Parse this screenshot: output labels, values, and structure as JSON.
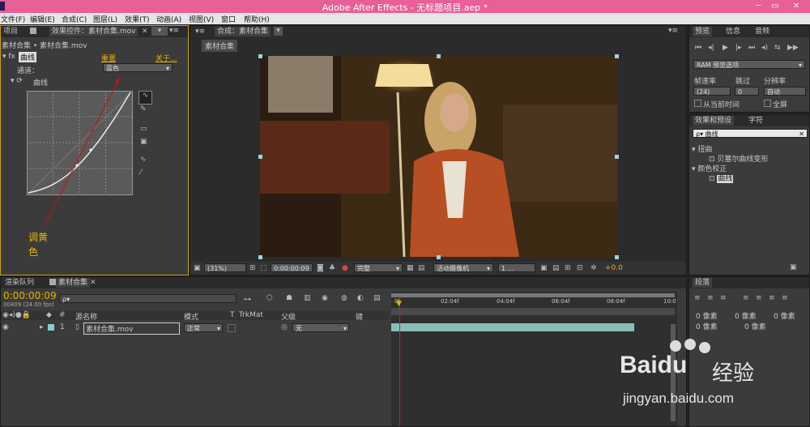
{
  "window": {
    "title": "Adobe After Effects - 无标题项目.aep *",
    "min": "─",
    "max": "▭",
    "close": "✕"
  },
  "menu": [
    "文件(F)",
    "编辑(E)",
    "合成(C)",
    "图层(L)",
    "效果(T)",
    "动画(A)",
    "视图(V)",
    "窗口",
    "帮助(H)"
  ],
  "left_panel": {
    "tabs": [
      "项目",
      "效果控件：素材合集.mov"
    ],
    "subtitle": "素材合集 • 素材合集.mov",
    "fx_name": "曲线",
    "reset": "重置",
    "about": "关于...",
    "channel_label": "通道：",
    "channel_value": "蓝色",
    "curve_label": "曲线"
  },
  "annotation": {
    "line1": "调黄",
    "line2": "色"
  },
  "comp_panel": {
    "tab": "合成：素材合集",
    "sub_tab": "素材合集",
    "zoom": "(31%)",
    "timecode": "0:00:00:09",
    "quality": "完整",
    "camera": "活动摄像机",
    "views": "1 ...",
    "exposure": "+0.0"
  },
  "preview_panel": {
    "tabs": [
      "预览",
      "信息",
      "音频"
    ],
    "ram_label": "RAM 预览选项",
    "fps_label": "帧速率",
    "skip_label": "跳过",
    "res_label": "分辨率",
    "fps_value": "(24)",
    "skip_value": "0",
    "res_value": "自动",
    "from_current": "从当前时间",
    "fullscreen": "全屏"
  },
  "effects_panel": {
    "tabs": [
      "效果和预设",
      "字符"
    ],
    "search": "曲线",
    "groups": [
      {
        "name": "扭曲",
        "items": [
          "贝塞尔曲线变形"
        ]
      },
      {
        "name": "颜色校正",
        "items": [
          "曲线"
        ]
      }
    ]
  },
  "paragraph_panel": {
    "tab": "段落",
    "values": [
      "0 像素",
      "0 像素",
      "0 像素",
      "0 像素",
      "0 像素"
    ]
  },
  "timeline": {
    "tabs": [
      "渲染队列",
      "素材合集"
    ],
    "timecode": "0:00:00:09",
    "frame_info": "00409 (24.00 fps)",
    "search_placeholder": "ρ▾",
    "columns": [
      "源名称",
      "模式",
      "T",
      "TrkMat",
      "父级",
      "键"
    ],
    "ruler": [
      "0f",
      "02:04f",
      "04:04f",
      "06:04f",
      "08:04f",
      "10:0"
    ],
    "layer": {
      "index": "1",
      "name": "素材合集.mov",
      "mode": "正常",
      "parent": "无"
    }
  },
  "watermark": {
    "brand": "Baidu",
    "cn": "经验",
    "url": "jingyan.baidu.com"
  }
}
